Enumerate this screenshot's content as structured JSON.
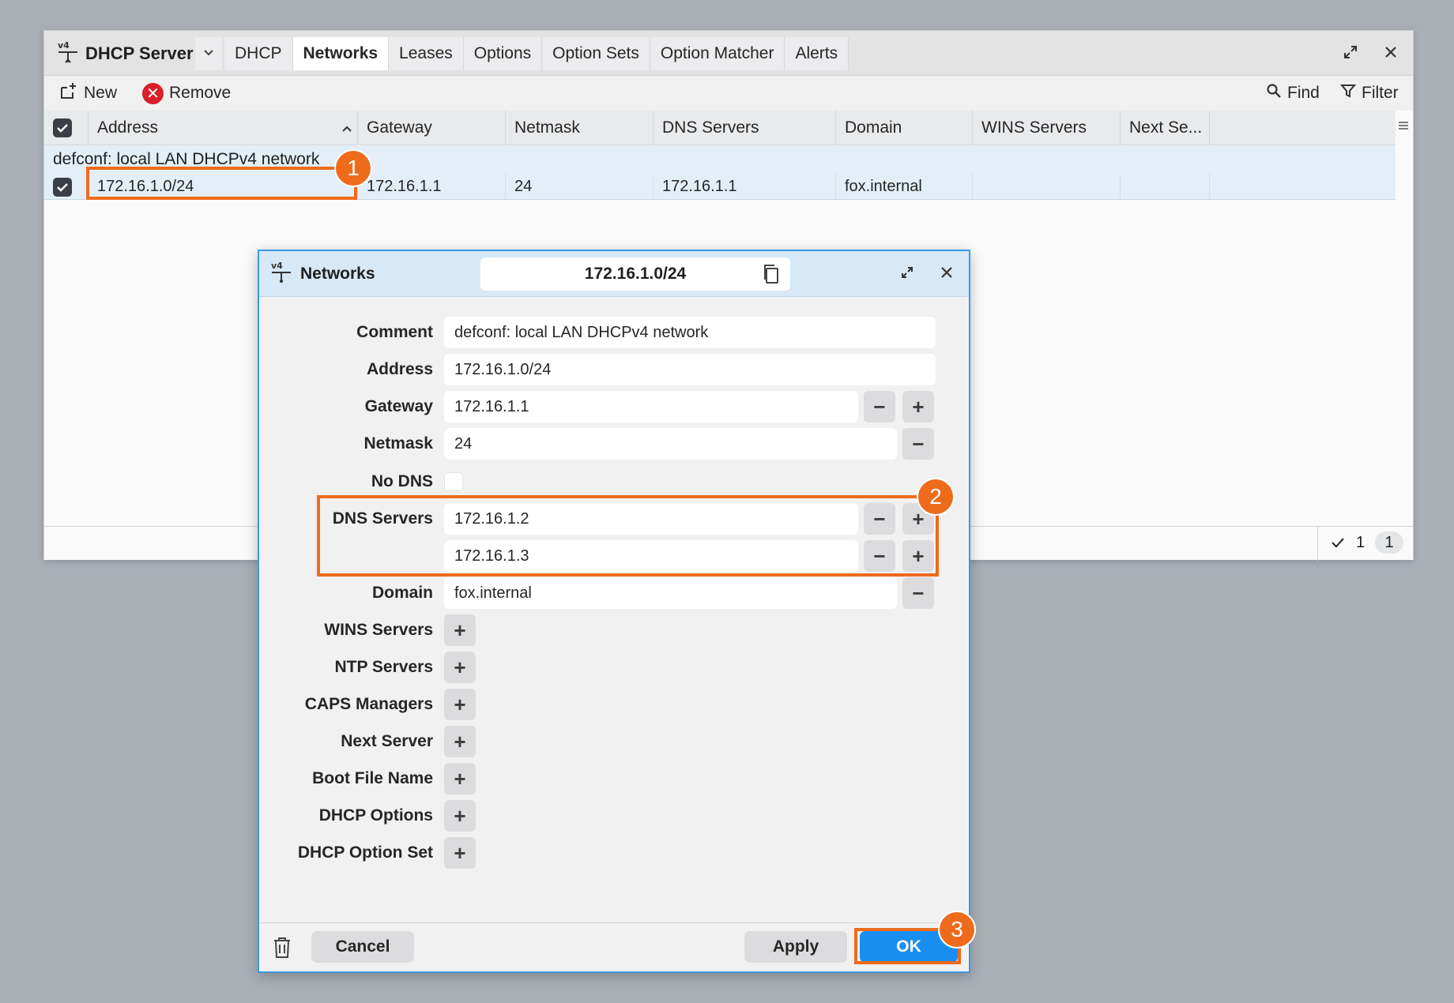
{
  "main": {
    "app_name": "DHCP Server",
    "tabs": [
      "DHCP",
      "Networks",
      "Leases",
      "Options",
      "Option Sets",
      "Option Matcher",
      "Alerts"
    ],
    "active_tab": "Networks",
    "toolbar": {
      "new_label": "New",
      "remove_label": "Remove",
      "find_label": "Find",
      "filter_label": "Filter"
    },
    "columns": [
      "Address",
      "Gateway",
      "Netmask",
      "DNS Servers",
      "Domain",
      "WINS Servers",
      "Next Se..."
    ],
    "group_label": "defconf: local LAN DHCPv4 network",
    "row": {
      "address": "172.16.1.0/24",
      "gateway": "172.16.1.1",
      "netmask": "24",
      "dns": "172.16.1.1",
      "domain": "fox.internal",
      "wins": "",
      "next": ""
    },
    "status": {
      "selected": "1",
      "total": "1"
    }
  },
  "dialog": {
    "title": "Networks",
    "header_value": "172.16.1.0/24",
    "fields": {
      "comment_label": "Comment",
      "comment": "defconf: local LAN DHCPv4 network",
      "address_label": "Address",
      "address": "172.16.1.0/24",
      "gateway_label": "Gateway",
      "gateway": "172.16.1.1",
      "netmask_label": "Netmask",
      "netmask": "24",
      "nodns_label": "No DNS",
      "dns_label": "DNS Servers",
      "dns1": "172.16.1.2",
      "dns2": "172.16.1.3",
      "domain_label": "Domain",
      "domain": "fox.internal",
      "wins_label": "WINS Servers",
      "ntp_label": "NTP Servers",
      "caps_label": "CAPS Managers",
      "next_label": "Next Server",
      "boot_label": "Boot File Name",
      "dhcpopt_label": "DHCP Options",
      "dhcpset_label": "DHCP Option Set"
    },
    "buttons": {
      "cancel": "Cancel",
      "apply": "Apply",
      "ok": "OK"
    }
  },
  "annotations": [
    "1",
    "2",
    "3"
  ],
  "colors": {
    "accent": "#1a8ef0",
    "highlight": "#ef6b1c",
    "remove": "#d81f2a"
  }
}
